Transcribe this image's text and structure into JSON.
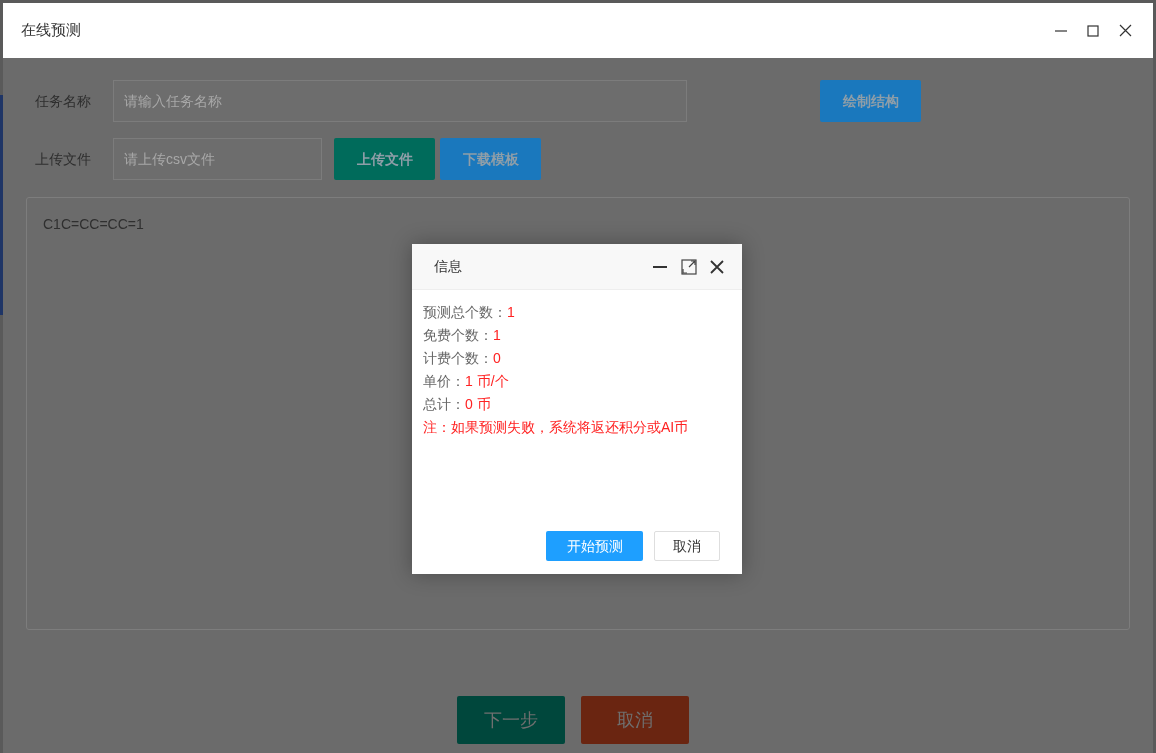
{
  "window": {
    "title": "在线预测"
  },
  "form": {
    "fields": [
      {
        "label": "任务名称",
        "placeholder": "请输入任务名称"
      },
      {
        "label": "上传文件",
        "placeholder": "请上传csv文件"
      }
    ],
    "draw_button": {
      "label": "绘制结构",
      "color": "#1a78bd"
    },
    "file_buttons": [
      {
        "label": "上传文件",
        "color": "#006b5b"
      },
      {
        "label": "下载模板",
        "color": "#1a78bd"
      }
    ]
  },
  "editor": {
    "value": "C1C=CC=CC=1"
  },
  "footer_buttons": [
    {
      "label": "下一步",
      "color": "#00473c"
    },
    {
      "label": "取消",
      "color": "#6a2511"
    }
  ],
  "dialog": {
    "title": "信息",
    "lines": [
      {
        "label": "预测总个数：",
        "value": "1"
      },
      {
        "label": "免费个数：",
        "value": "1"
      },
      {
        "label": "计费个数：",
        "value": "0"
      },
      {
        "label": "单价：",
        "value": "1 币/个"
      },
      {
        "label": "总计：",
        "value": "0 币"
      }
    ],
    "note": "注：如果预测失败，系统将返还积分或AI币",
    "buttons": [
      {
        "label": "开始预测",
        "kind": "primary"
      },
      {
        "label": "取消",
        "kind": "plain"
      }
    ]
  }
}
